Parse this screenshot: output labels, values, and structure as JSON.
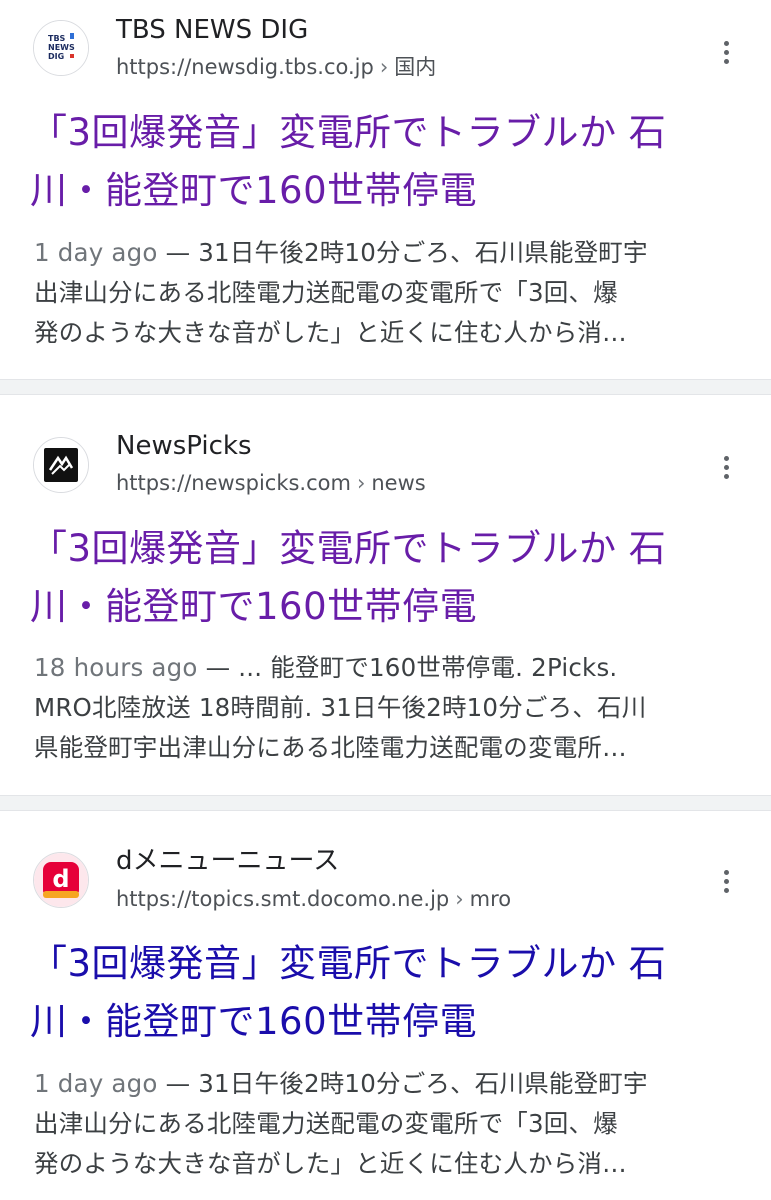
{
  "results": [
    {
      "site_name": "TBS NEWS DIG",
      "url": "https://newsdig.tbs.co.jp",
      "breadcrumb": "国内",
      "title_line_1": "「3回爆発音」変電所でトラブルか 石",
      "title_line_2": "川・能登町で160世帯停電",
      "date": "1 day ago",
      "snippet_line_1": " — 31日午後2時10分ごろ、石川県能登町宇",
      "snippet_line_2": "出津山分にある北陸電力送配電の変電所で「3回、爆",
      "snippet_line_3": "発のような大きな音がした」と近くに住む人から消…",
      "favicon_text": [
        "TBS",
        "NEWS",
        "DIG"
      ],
      "title_color": "#681da8"
    },
    {
      "site_name": "NewsPicks",
      "url": "https://newspicks.com",
      "breadcrumb": "news",
      "title_line_1": "「3回爆発音」変電所でトラブルか 石",
      "title_line_2": "川・能登町で160世帯停電",
      "date": "18 hours ago",
      "snippet_line_1": " — ... 能登町で160世帯停電. 2Picks.",
      "snippet_line_2": "MRO北陸放送 18時間前. 31日午後2時10分ごろ、石川",
      "snippet_line_3": "県能登町宇出津山分にある北陸電力送配電の変電所…",
      "title_color": "#681da8"
    },
    {
      "site_name": "dメニューニュース",
      "url": "https://topics.smt.docomo.ne.jp",
      "breadcrumb": "mro",
      "title_line_1": "「3回爆発音」変電所でトラブルか 石",
      "title_line_2": "川・能登町で160世帯停電",
      "date": "1 day ago",
      "snippet_line_1": " — 31日午後2時10分ごろ、石川県能登町宇",
      "snippet_line_2": "出津山分にある北陸電力送配電の変電所で「3回、爆",
      "snippet_line_3": "発のような大きな音がした」と近くに住む人から消…",
      "favicon_text": "d",
      "title_color": "#1a0dab"
    }
  ],
  "icons": {
    "more": "more-vert-icon",
    "breadcrumb_separator": "›"
  },
  "colors": {
    "visited_title": "#681da8",
    "link_title": "#1a0dab",
    "url_text": "#4d5156",
    "snippet_text": "#3c4043",
    "separator": "#f1f3f4"
  }
}
